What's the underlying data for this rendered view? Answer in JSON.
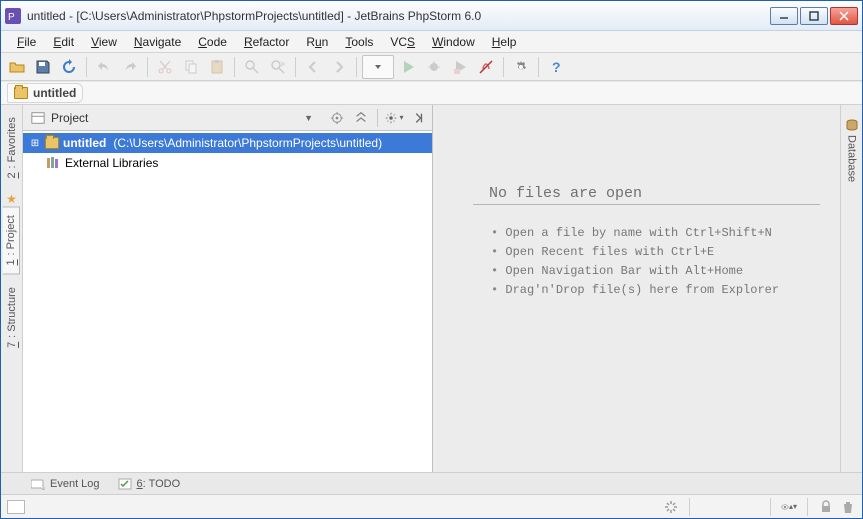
{
  "window": {
    "title": "untitled - [C:\\Users\\Administrator\\PhpstormProjects\\untitled] - JetBrains PhpStorm 6.0"
  },
  "menu": {
    "file": "File",
    "edit": "Edit",
    "view": "View",
    "navigate": "Navigate",
    "code": "Code",
    "refactor": "Refactor",
    "run": "Run",
    "tools": "Tools",
    "vcs": "VCS",
    "window": "Window",
    "help": "Help"
  },
  "breadcrumb": {
    "root": "untitled"
  },
  "left_tabs": {
    "favorites": "2: Favorites",
    "project": "1: Project",
    "structure": "7: Structure"
  },
  "right_tabs": {
    "database": "Database"
  },
  "project_panel": {
    "title": "Project",
    "root_name": "untitled",
    "root_path": "(C:\\Users\\Administrator\\PhpstormProjects\\untitled)",
    "external_libs": "External Libraries"
  },
  "editor_empty": {
    "title": "No files are open",
    "hints": [
      "Open a file by name with Ctrl+Shift+N",
      "Open Recent files with Ctrl+E",
      "Open Navigation Bar with Alt+Home",
      "Drag'n'Drop file(s) here from Explorer"
    ]
  },
  "bottom": {
    "event_log": "Event Log",
    "todo": "6: TODO"
  }
}
